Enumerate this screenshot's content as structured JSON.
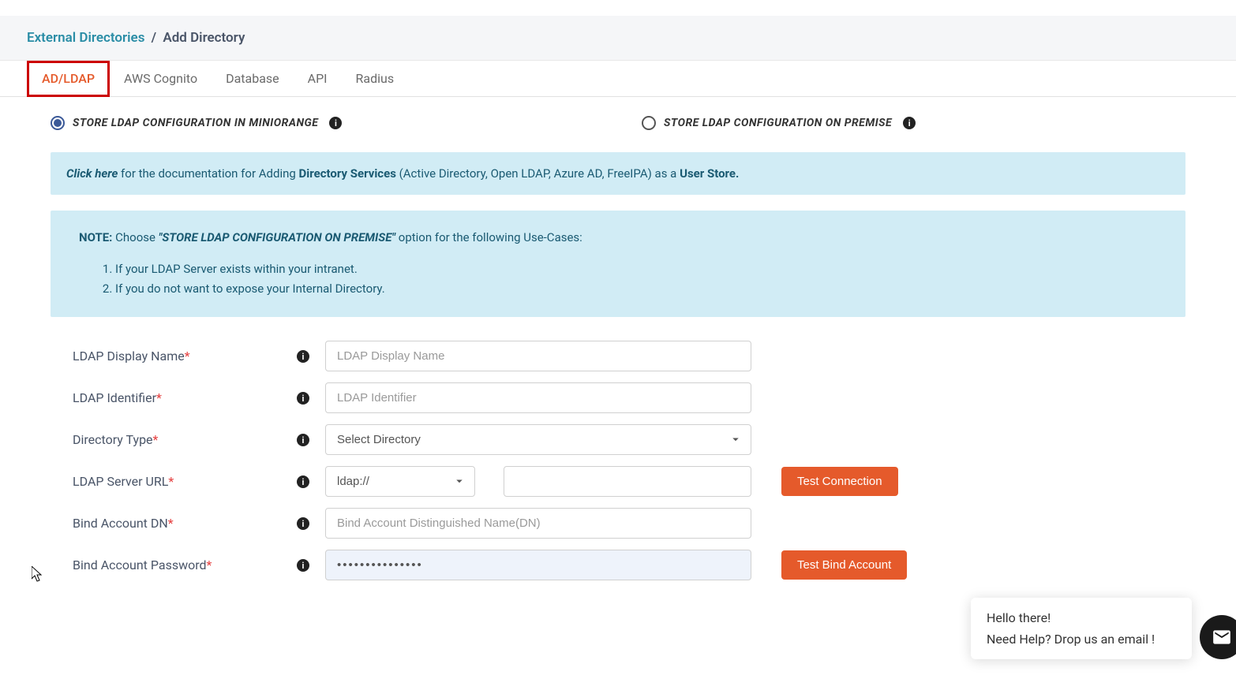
{
  "breadcrumb": {
    "link": "External Directories",
    "sep": "/",
    "current": "Add Directory"
  },
  "tabs": {
    "adldap": "AD/LDAP",
    "cognito": "AWS Cognito",
    "database": "Database",
    "api": "API",
    "radius": "Radius"
  },
  "radios": {
    "miniorange": "STORE LDAP CONFIGURATION IN MINIORANGE",
    "premise": "STORE LDAP CONFIGURATION ON PREMISE"
  },
  "doc_box": {
    "click": "Click here",
    "t1": " for the documentation for Adding ",
    "bold1": "Directory Services",
    "t2": " (Active Directory, Open LDAP, Azure AD, FreeIPA) as a ",
    "bold2": "User Store."
  },
  "note_box": {
    "label": "NOTE:",
    "t1": "  Choose ",
    "emph": "\"STORE LDAP CONFIGURATION ON PREMISE\"",
    "t2": " option for the following Use-Cases:",
    "item1": "If your LDAP Server exists within your intranet.",
    "item2": "If you do not want to expose your Internal Directory."
  },
  "form": {
    "display_name": {
      "label": "LDAP Display Name",
      "placeholder": "LDAP Display Name"
    },
    "identifier": {
      "label": "LDAP Identifier",
      "placeholder": "LDAP Identifier"
    },
    "dir_type": {
      "label": "Directory Type",
      "selected": "Select Directory"
    },
    "server_url": {
      "label": "LDAP Server URL",
      "protocol": "ldap://"
    },
    "bind_dn": {
      "label": "Bind Account DN",
      "placeholder": "Bind Account Distinguished Name(DN)"
    },
    "bind_pwd": {
      "label": "Bind Account Password",
      "value": "•••••••••••••••"
    }
  },
  "buttons": {
    "test_conn": "Test Connection",
    "test_bind": "Test Bind Account"
  },
  "chat": {
    "greet": "Hello there!",
    "help": "Need Help? Drop us an email !"
  }
}
